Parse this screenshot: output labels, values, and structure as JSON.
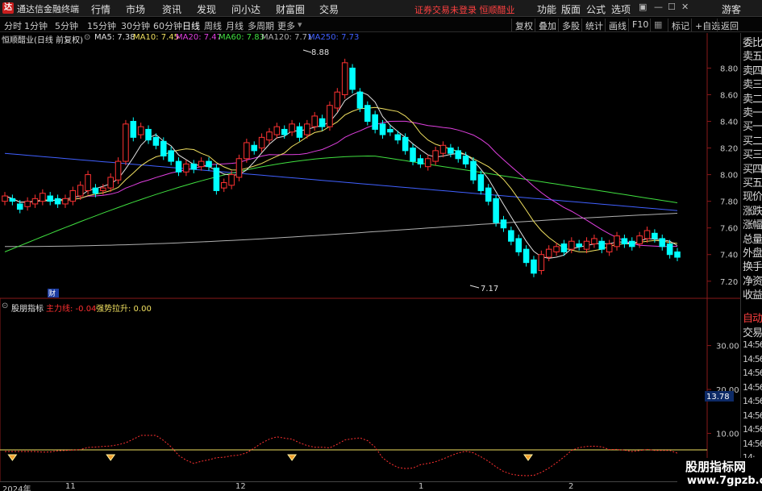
{
  "titlebar": {
    "logo_glyph": "达",
    "app_name": "通达信金融终端",
    "menus": [
      "行情",
      "市场",
      "资讯",
      "发现",
      "问小达",
      "财富圈",
      "交易"
    ],
    "warning": "证券交易未登录  恒顺醋业",
    "right_menus": [
      "功能",
      "版面",
      "公式",
      "选项"
    ],
    "guest": "游客"
  },
  "periodbar": {
    "periods": [
      "分时",
      "1分钟",
      "5分钟",
      "15分钟",
      "30分钟",
      "60分钟",
      "日线",
      "周线",
      "月线",
      "多周期",
      "更多"
    ],
    "active": "日线",
    "right_buttons": [
      "复权",
      "叠加",
      "多股",
      "统计",
      "画线",
      "F10",
      "标记",
      "+自选",
      "返回"
    ]
  },
  "main": {
    "stock_label": "恒顺醋业(日线 前复权)",
    "ma": [
      {
        "label": "MA5: 7.38",
        "color": "#e0e0e0"
      },
      {
        "label": "MA10: 7.45",
        "color": "#f0e060"
      },
      {
        "label": "MA20: 7.47",
        "color": "#e040e0"
      },
      {
        "label": "MA60: 7.83",
        "color": "#40e040"
      },
      {
        "label": "MA120: 7.71",
        "color": "#b0b0b0"
      },
      {
        "label": "MA250: 7.73",
        "color": "#4060ff"
      }
    ],
    "high_label": "8.88",
    "low_label": "7.17",
    "cai_label": "财",
    "y_ticks": [
      "8.80",
      "8.60",
      "8.40",
      "8.20",
      "8.00",
      "7.80",
      "7.60",
      "7.40",
      "7.20"
    ]
  },
  "indicator": {
    "name": "股朋指标",
    "line1_label": "主力线: -0.04",
    "line1_color": "#ff3030",
    "line2_label": "强势拉升: 0.00",
    "line2_color": "#f0e060",
    "y_ticks": [
      "30.00",
      "20.00",
      "10.00"
    ],
    "current_value": "13.78"
  },
  "quote_panel": {
    "items": [
      "委比",
      "卖五",
      "卖四",
      "卖三",
      "卖二",
      "卖一",
      "买一",
      "买二",
      "买三",
      "买四",
      "买五",
      "现价",
      "涨跌",
      "涨幅",
      "总量",
      "外盘",
      "换手",
      "净资",
      "收益"
    ],
    "tabs": [
      "自动",
      "交易"
    ],
    "times": [
      "14:56",
      "14:56",
      "14:56",
      "14:56",
      "14:56",
      "14:56",
      "14:56",
      "14:56",
      "14:"
    ]
  },
  "date_axis": [
    "2024年",
    "11",
    "12",
    "1",
    "2"
  ],
  "watermark": {
    "line1": "股朋指标网",
    "line2": "www.7gpzb.com"
  },
  "colors": {
    "up": "#ff3232",
    "down": "#00ffff",
    "ma5": "#e0e0e0",
    "ma10": "#f0e060",
    "ma20": "#e040e0",
    "ma60": "#40e040",
    "ma120": "#b0b0b0",
    "ma250": "#4060ff"
  },
  "chart_data": {
    "type": "candlestick",
    "x": [
      "2024-10-08",
      "2024-10-09",
      "2024-10-10",
      "2024-10-11",
      "2024-10-14",
      "2024-10-15",
      "2024-10-16",
      "2024-10-17",
      "2024-10-18",
      "2024-10-21",
      "2024-10-22",
      "2024-10-23",
      "2024-10-24",
      "2024-10-25",
      "2024-10-28",
      "2024-10-29",
      "2024-10-30",
      "2024-10-31",
      "2024-11-01",
      "2024-11-04",
      "2024-11-05",
      "2024-11-06",
      "2024-11-07",
      "2024-11-08",
      "2024-11-11",
      "2024-11-12",
      "2024-11-13",
      "2024-11-14",
      "2024-11-15",
      "2024-11-18",
      "2024-11-19",
      "2024-11-20",
      "2024-11-21",
      "2024-11-22",
      "2024-11-25",
      "2024-11-26",
      "2024-11-27",
      "2024-11-28",
      "2024-11-29",
      "2024-12-02",
      "2024-12-03",
      "2024-12-04",
      "2024-12-05",
      "2024-12-06",
      "2024-12-09",
      "2024-12-10",
      "2024-12-11",
      "2024-12-12",
      "2024-12-13",
      "2024-12-16",
      "2024-12-17",
      "2024-12-18",
      "2024-12-19",
      "2024-12-20",
      "2024-12-23",
      "2024-12-24",
      "2024-12-25",
      "2024-12-26",
      "2024-12-27",
      "2024-12-30",
      "2024-12-31",
      "2025-01-02",
      "2025-01-03",
      "2025-01-06",
      "2025-01-07",
      "2025-01-08",
      "2025-01-09",
      "2025-01-10",
      "2025-01-13",
      "2025-01-14",
      "2025-01-15",
      "2025-01-16",
      "2025-01-17",
      "2025-01-20",
      "2025-01-21",
      "2025-01-22",
      "2025-01-23",
      "2025-01-24",
      "2025-01-27",
      "2025-02-05",
      "2025-02-06",
      "2025-02-07",
      "2025-02-10",
      "2025-02-11",
      "2025-02-12",
      "2025-02-13",
      "2025-02-14",
      "2025-02-17",
      "2025-02-18",
      "2025-02-19"
    ],
    "ohlc_note": "OHLC values estimated from the candle drawing",
    "open": [
      7.8,
      7.82,
      7.78,
      7.76,
      7.78,
      7.8,
      7.84,
      7.82,
      7.78,
      7.8,
      7.84,
      7.88,
      7.9,
      7.88,
      7.9,
      7.96,
      8.1,
      8.4,
      8.3,
      8.34,
      8.28,
      8.25,
      8.18,
      8.1,
      8.02,
      8.08,
      8.06,
      8.1,
      8.05,
      7.9,
      7.92,
      7.98,
      8.12,
      8.22,
      8.2,
      8.26,
      8.3,
      8.34,
      8.32,
      8.36,
      8.3,
      8.36,
      8.42,
      8.36,
      8.5,
      8.6,
      8.8,
      8.62,
      8.52,
      8.45,
      8.38,
      8.34,
      8.3,
      8.28,
      8.2,
      8.12,
      8.06,
      8.1,
      8.16,
      8.2,
      8.18,
      8.14,
      8.1,
      8.0,
      7.9,
      7.82,
      7.66,
      7.58,
      7.52,
      7.44,
      7.36,
      7.28,
      7.38,
      7.42,
      7.48,
      7.44,
      7.48,
      7.44,
      7.48,
      7.5,
      7.42,
      7.46,
      7.52,
      7.5,
      7.48,
      7.52,
      7.56,
      7.52,
      7.48,
      7.42
    ],
    "close": [
      7.84,
      7.8,
      7.74,
      7.8,
      7.82,
      7.86,
      7.8,
      7.78,
      7.82,
      7.88,
      7.92,
      8.0,
      7.86,
      7.9,
      7.98,
      8.1,
      8.38,
      8.28,
      8.36,
      8.26,
      8.22,
      8.14,
      8.1,
      8.02,
      8.08,
      8.04,
      8.1,
      8.06,
      7.88,
      7.94,
      8.0,
      8.12,
      8.24,
      8.18,
      8.28,
      8.32,
      8.36,
      8.3,
      8.38,
      8.28,
      8.38,
      8.44,
      8.36,
      8.52,
      8.62,
      8.84,
      8.64,
      8.5,
      8.4,
      8.34,
      8.3,
      8.32,
      8.26,
      8.18,
      8.1,
      8.08,
      8.12,
      8.18,
      8.22,
      8.16,
      8.12,
      8.08,
      7.96,
      7.88,
      7.8,
      7.64,
      7.6,
      7.5,
      7.42,
      7.34,
      7.26,
      7.4,
      7.44,
      7.46,
      7.42,
      7.5,
      7.46,
      7.5,
      7.52,
      7.44,
      7.48,
      7.54,
      7.48,
      7.46,
      7.54,
      7.58,
      7.52,
      7.46,
      7.4,
      7.38
    ],
    "ylim": [
      7.12,
      8.96
    ],
    "indicator_ylim": [
      0,
      38
    ]
  }
}
